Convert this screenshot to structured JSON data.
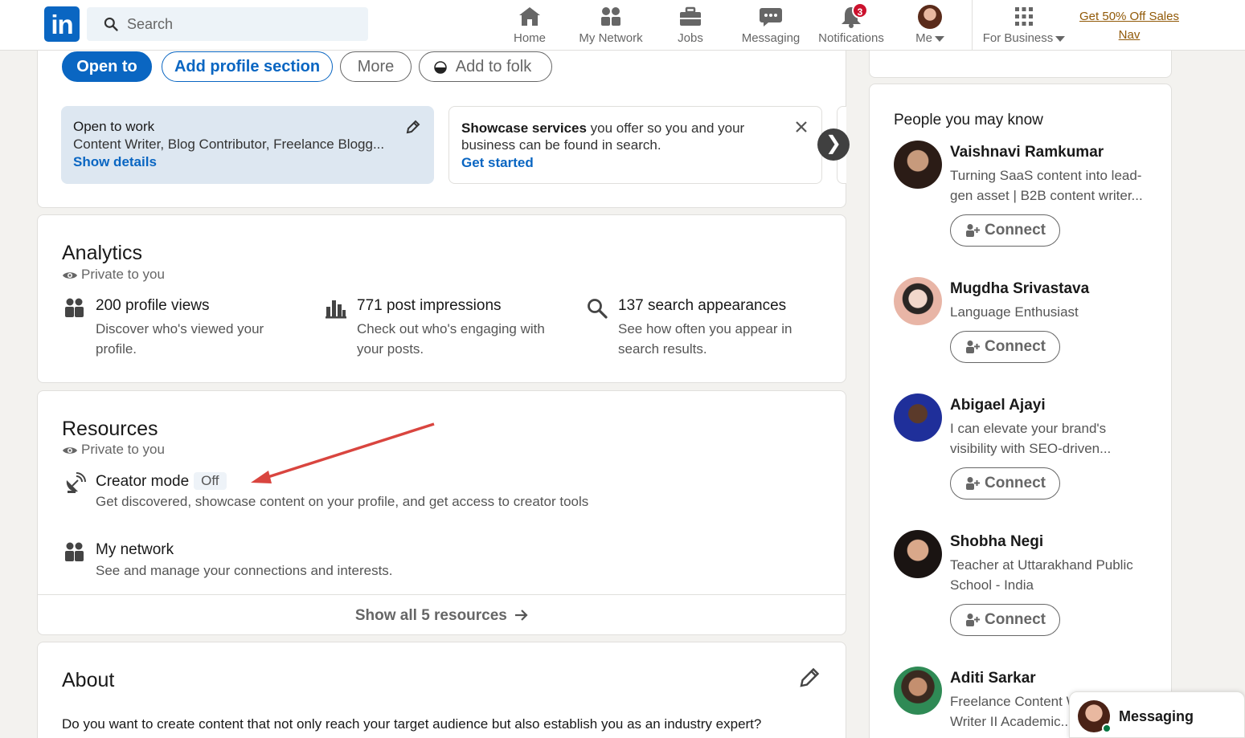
{
  "nav": {
    "logo": "in",
    "search_placeholder": "Search",
    "items": [
      {
        "label": "Home",
        "icon": "home-icon"
      },
      {
        "label": "My Network",
        "icon": "people-icon"
      },
      {
        "label": "Jobs",
        "icon": "briefcase-icon"
      },
      {
        "label": "Messaging",
        "icon": "chat-icon"
      },
      {
        "label": "Notifications",
        "icon": "bell-icon",
        "badge": "3"
      },
      {
        "label": "Me",
        "icon": "avatar"
      },
      {
        "label": "For Business",
        "icon": "grid-icon"
      }
    ],
    "promo_line1": "Get 50% Off Sales",
    "promo_line2": "Nav"
  },
  "profile_actions": {
    "open_to": "Open to",
    "add_section": "Add profile section",
    "more": "More",
    "add_to_folk": "Add to folk"
  },
  "open_to_work": {
    "title": "Open to work",
    "roles": "Content Writer, Blog Contributor, Freelance Blogg...",
    "link": "Show details"
  },
  "showcase": {
    "bold": "Showcase services",
    "text": " you offer so you and your business can be found in search.",
    "link": "Get started"
  },
  "analytics": {
    "title": "Analytics",
    "privacy": "Private to you",
    "metrics": [
      {
        "title": "200 profile views",
        "desc": "Discover who's viewed your profile.",
        "icon": "people-icon"
      },
      {
        "title": "771 post impressions",
        "desc": "Check out who's engaging with your posts.",
        "icon": "bar-chart-icon"
      },
      {
        "title": "137 search appearances",
        "desc": "See how often you appear in search results.",
        "icon": "search-icon"
      }
    ]
  },
  "resources": {
    "title": "Resources",
    "privacy": "Private to you",
    "items": [
      {
        "title": "Creator mode",
        "status": "Off",
        "desc": "Get discovered, showcase content on your profile, and get access to creator tools",
        "icon": "satellite-dish-icon"
      },
      {
        "title": "My network",
        "desc": "See and manage your connections and interests.",
        "icon": "people-icon"
      }
    ],
    "show_all": "Show all 5 resources"
  },
  "about": {
    "title": "About",
    "text": "Do you want to create content that not only reach your target audience but also establish you as an industry expert?"
  },
  "pymk": {
    "title": "People you may know",
    "connect_label": "Connect",
    "people": [
      {
        "name": "Vaishnavi Ramkumar",
        "headline": "Turning SaaS content into lead-gen asset | B2B content writer..."
      },
      {
        "name": "Mugdha Srivastava",
        "headline": "Language Enthusiast"
      },
      {
        "name": "Abigael Ajayi",
        "headline": "I can elevate your brand's visibility with SEO-driven..."
      },
      {
        "name": "Shobha Negi",
        "headline": "Teacher at Uttarakhand Public School - India"
      },
      {
        "name": "Aditi Sarkar",
        "headline": "Freelance Content Writer | Blog Writer II Academic..."
      }
    ]
  },
  "messaging_bar": {
    "label": "Messaging"
  },
  "colors": {
    "brand": "#0a66c2",
    "badge": "#cb112d",
    "promo": "#915907",
    "annotation_arrow": "#d9453f"
  }
}
